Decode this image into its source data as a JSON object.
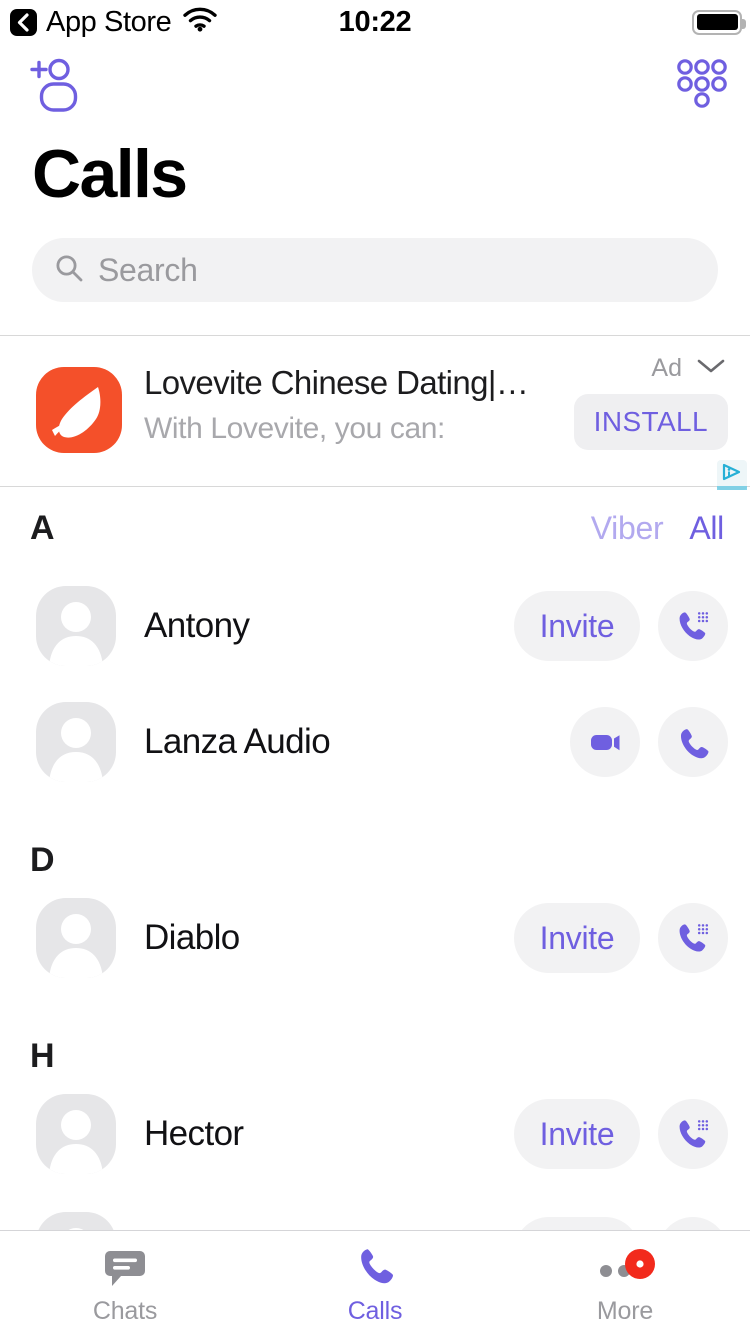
{
  "status_bar": {
    "back_label": "App Store",
    "back_icon": "chevron-left-icon",
    "wifi_icon": "wifi-icon",
    "time": "10:22",
    "battery_icon": "battery-full-icon"
  },
  "nav": {
    "add_contact_icon": "add-contact-icon",
    "keypad_icon": "keypad-icon"
  },
  "header": {
    "title": "Calls"
  },
  "search": {
    "icon": "search-icon",
    "placeholder": "Search",
    "value": ""
  },
  "ad": {
    "label": "Ad",
    "chevron_icon": "chevron-down-icon",
    "app_icon": "lovevite-app-icon",
    "title": "Lovevite Chinese Dating|…",
    "subtitle": "With Lovevite, you can:",
    "install_label": "INSTALL",
    "adchoices_icon": "adchoices-icon",
    "accent_color": "#f4502a"
  },
  "filters": {
    "options": [
      "Viber",
      "All"
    ],
    "selected": "All",
    "viber_label": "Viber",
    "all_label": "All"
  },
  "theme": {
    "accent": "#6f5fe0",
    "accent_light": "#b2a9ef",
    "pill_bg": "#f2f2f3",
    "muted_text": "#9a9a9e",
    "badge_red": "#f22a1c"
  },
  "sections": [
    {
      "letter": "A",
      "contacts": [
        {
          "name": "Antony",
          "avatar_icon": "avatar-placeholder-icon",
          "invite_label": "Invite",
          "call_icon": "viber-out-phone-icon",
          "has_invite": true,
          "has_video": false
        },
        {
          "name": "Lanza Audio",
          "avatar_icon": "avatar-placeholder-icon",
          "invite_label": "",
          "call_icon": "phone-icon",
          "video_icon": "video-camera-icon",
          "has_invite": false,
          "has_video": true
        }
      ]
    },
    {
      "letter": "D",
      "contacts": [
        {
          "name": "Diablo",
          "avatar_icon": "avatar-placeholder-icon",
          "invite_label": "Invite",
          "call_icon": "viber-out-phone-icon",
          "has_invite": true,
          "has_video": false
        }
      ]
    },
    {
      "letter": "H",
      "contacts": [
        {
          "name": "Hector",
          "avatar_icon": "avatar-placeholder-icon",
          "invite_label": "Invite",
          "call_icon": "viber-out-phone-icon",
          "has_invite": true,
          "has_video": false
        }
      ]
    }
  ],
  "tabs": [
    {
      "label": "Chats",
      "icon": "chat-bubble-icon",
      "active": false,
      "badge": false
    },
    {
      "label": "Calls",
      "icon": "phone-icon",
      "active": true,
      "badge": false
    },
    {
      "label": "More",
      "icon": "more-dots-icon",
      "active": false,
      "badge": true
    }
  ]
}
